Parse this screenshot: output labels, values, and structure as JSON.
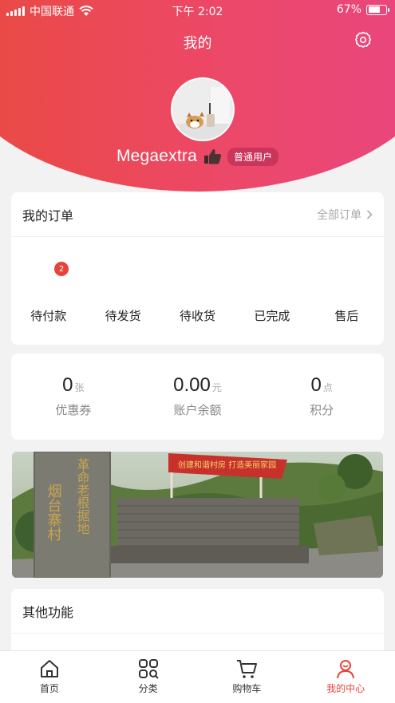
{
  "status_bar": {
    "carrier": "中国联通",
    "time": "下午 2:02",
    "battery": "67%"
  },
  "header": {
    "title": "我的",
    "username": "Megaextra",
    "role": "普通用户"
  },
  "orders": {
    "title": "我的订单",
    "link": "全部订单",
    "items": [
      {
        "label": "待付款",
        "badge": "2"
      },
      {
        "label": "待发货"
      },
      {
        "label": "待收货"
      },
      {
        "label": "已完成"
      },
      {
        "label": "售后"
      }
    ]
  },
  "assets": [
    {
      "value": "0",
      "unit": "张",
      "label": "优惠券"
    },
    {
      "value": "0.00",
      "unit": "元",
      "label": "账户余额"
    },
    {
      "value": "0",
      "unit": "点",
      "label": "积分"
    }
  ],
  "banner": {
    "stone_text_left": "烟台寨村",
    "stone_text_right": "革命老根据地",
    "sign_text": "创建和谐村房  打造美丽家园"
  },
  "more": {
    "title": "其他功能"
  },
  "tabs": [
    {
      "label": "首页",
      "icon": "home-icon"
    },
    {
      "label": "分类",
      "icon": "category-icon"
    },
    {
      "label": "购物车",
      "icon": "cart-icon"
    },
    {
      "label": "我的中心",
      "icon": "user-icon",
      "active": true
    }
  ],
  "colors": {
    "accent": "#e8433a",
    "gradient_start": "#ea4a3f",
    "gradient_end": "#e94682"
  }
}
